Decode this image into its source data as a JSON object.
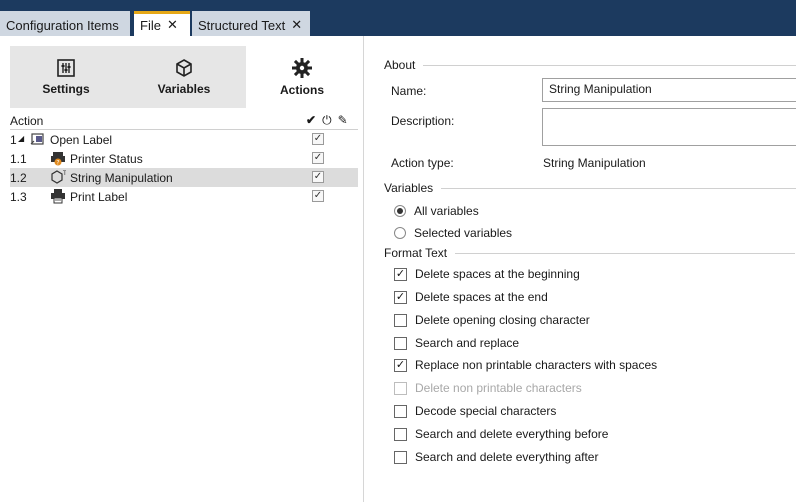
{
  "tabs": [
    {
      "label": "Configuration Items",
      "active": false,
      "closable": false
    },
    {
      "label": "File",
      "active": true,
      "closable": true
    },
    {
      "label": "Structured Text",
      "active": false,
      "closable": true
    }
  ],
  "toolbar": {
    "settings_label": "Settings",
    "variables_label": "Variables",
    "actions_label": "Actions"
  },
  "grid": {
    "header": "Action",
    "header_icons": [
      "✔",
      "⏻",
      "✎"
    ],
    "rows": [
      {
        "num": "1",
        "expander": "◢",
        "label": "Open Label",
        "icon": "open-label-icon",
        "checked": true
      },
      {
        "num": "1.1",
        "label": "Printer Status",
        "icon": "printer-status-icon",
        "checked": true
      },
      {
        "num": "1.2",
        "label": "String Manipulation",
        "icon": "string-manipulation-icon",
        "checked": true,
        "selected": true
      },
      {
        "num": "1.3",
        "label": "Print Label",
        "icon": "printer-icon",
        "checked": true
      }
    ]
  },
  "about": {
    "title": "About",
    "name_label": "Name:",
    "name_value": "String Manipulation",
    "description_label": "Description:",
    "description_value": "",
    "action_type_label": "Action type:",
    "action_type_value": "String Manipulation"
  },
  "variables": {
    "title": "Variables",
    "all_label": "All variables",
    "selected_label": "Selected variables",
    "selected": "all"
  },
  "format_text": {
    "title": "Format Text",
    "options": [
      {
        "label": "Delete spaces at the beginning",
        "checked": true,
        "disabled": false
      },
      {
        "label": "Delete spaces at the end",
        "checked": true,
        "disabled": false
      },
      {
        "label": "Delete opening closing character",
        "checked": false,
        "disabled": false
      },
      {
        "label": "Search and replace",
        "checked": false,
        "disabled": false
      },
      {
        "label": "Replace non printable characters with spaces",
        "checked": true,
        "disabled": false
      },
      {
        "label": "Delete non printable characters",
        "checked": false,
        "disabled": true
      },
      {
        "label": "Decode special characters",
        "checked": false,
        "disabled": false
      },
      {
        "label": "Search and delete everything before",
        "checked": false,
        "disabled": false
      },
      {
        "label": "Search and delete everything after",
        "checked": false,
        "disabled": false
      }
    ]
  },
  "colors": {
    "tabbar_bg": "#1c3a5f",
    "active_tab_accent": "#e6a817",
    "selected_row_bg": "#dcdcdc"
  }
}
